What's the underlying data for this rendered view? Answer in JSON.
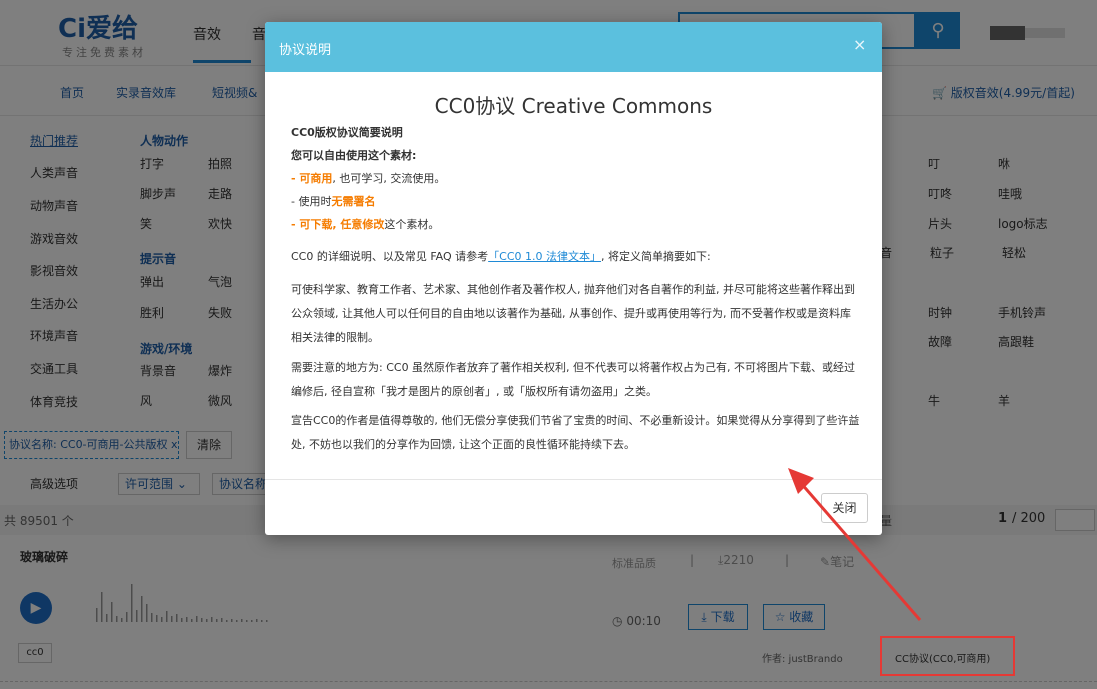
{
  "header": {
    "logo": "Ci爱给",
    "logo_sub": "专注免费素材",
    "nav": [
      "音效",
      "音"
    ],
    "search_icon": "search-icon"
  },
  "subnav": [
    "首页",
    "实录音效库",
    "短视频&"
  ],
  "cart": "版权音效(4.99元/首起)",
  "leftcats": [
    "热门推荐",
    "人类声音",
    "动物声音",
    "游戏音效",
    "影视音效",
    "生活办公",
    "环境声音",
    "交通工具",
    "体育竞技"
  ],
  "groups": {
    "g1": "人物动作",
    "g1_items": [
      [
        "打字",
        "拍照"
      ],
      [
        "脚步声",
        "走路"
      ],
      [
        "笑",
        "欢快"
      ]
    ],
    "g2": "提示音",
    "g2_items": [
      [
        "弹出",
        "气泡"
      ],
      [
        "胜利",
        "失败"
      ]
    ],
    "g3": "游戏/环境",
    "g3_items": [
      [
        "背景音",
        "爆炸"
      ],
      [
        "风",
        "微风"
      ]
    ]
  },
  "rightcats": [
    [
      "叮",
      "咻"
    ],
    [
      "叮咚",
      "哇哦"
    ],
    [
      "片头",
      "logo标志"
    ],
    [
      "粒子",
      "轻松"
    ],
    [
      "时钟",
      "手机铃声"
    ],
    [
      "故障",
      "高跟鞋"
    ],
    [
      "牛",
      "羊"
    ]
  ],
  "right_partial": "音",
  "filter": {
    "tag": "协议名称: CC0-可商用-公共版权 x",
    "clear": "清除"
  },
  "advanced": {
    "label": "高级选项",
    "sel1": "许可范围",
    "sel2": "协议名称"
  },
  "count": "共 89501 个",
  "quality_partial": "量",
  "pagination": {
    "current": "1",
    "total": "/ 200"
  },
  "item": {
    "title": "玻璃破碎",
    "quality": "标准品质",
    "downloads": "2210",
    "notes": "笔记",
    "duration": "00:10",
    "download_btn": "下载",
    "fav_btn": "收藏",
    "tag": "cc0",
    "author": "作者: justBrando",
    "license": "CC协议(CC0,可商用)"
  },
  "modal": {
    "title": "协议说明",
    "close_x": "×",
    "heading": "CC0协议 Creative Commons",
    "l1": "CC0版权协议简要说明",
    "l2": "您可以自由使用这个素材:",
    "l3a": "- 可商用",
    "l3b": ", 也可学习, 交流使用。",
    "l4a": "- 使用时",
    "l4b": "无需署名",
    "l5a": "- 可下载, 任意修改",
    "l5b": "这个素材。",
    "p1a": "CC0 的详细说明、以及常见 FAQ 请参考",
    "p1link": "「CC0 1.0 法律文本」",
    "p1b": ", 将定义简单摘要如下:",
    "p2": "可使科学家、教育工作者、艺术家、其他创作者及著作权人, 抛弃他们对各自著作的利益, 并尽可能将这些著作释出到公众领域, 让其他人可以任何目的自由地以该著作为基础, 从事创作、提升或再使用等行为, 而不受著作权或是资料库相关法律的限制。",
    "p3": "需要注意的地方为: CC0 虽然原作者放弃了著作相关权利, 但不代表可以将著作权占为己有, 不可将图片下载、或经过编修后, 径自宣称「我才是图片的原创者」, 或「版权所有请勿盗用」之类。",
    "p4": "宣告CC0的作者是值得尊敬的, 他们无偿分享使我们节省了宝贵的时间、不必重新设计。如果觉得从分享得到了些许益处, 不妨也以我们的分享作为回馈, 让这个正面的良性循环能持续下去。",
    "close_btn": "关闭"
  },
  "colors": {
    "accent": "#1f8ad6",
    "modal_header": "#5bc0de",
    "highlight": "#f57c00",
    "annotation": "#e53935"
  }
}
